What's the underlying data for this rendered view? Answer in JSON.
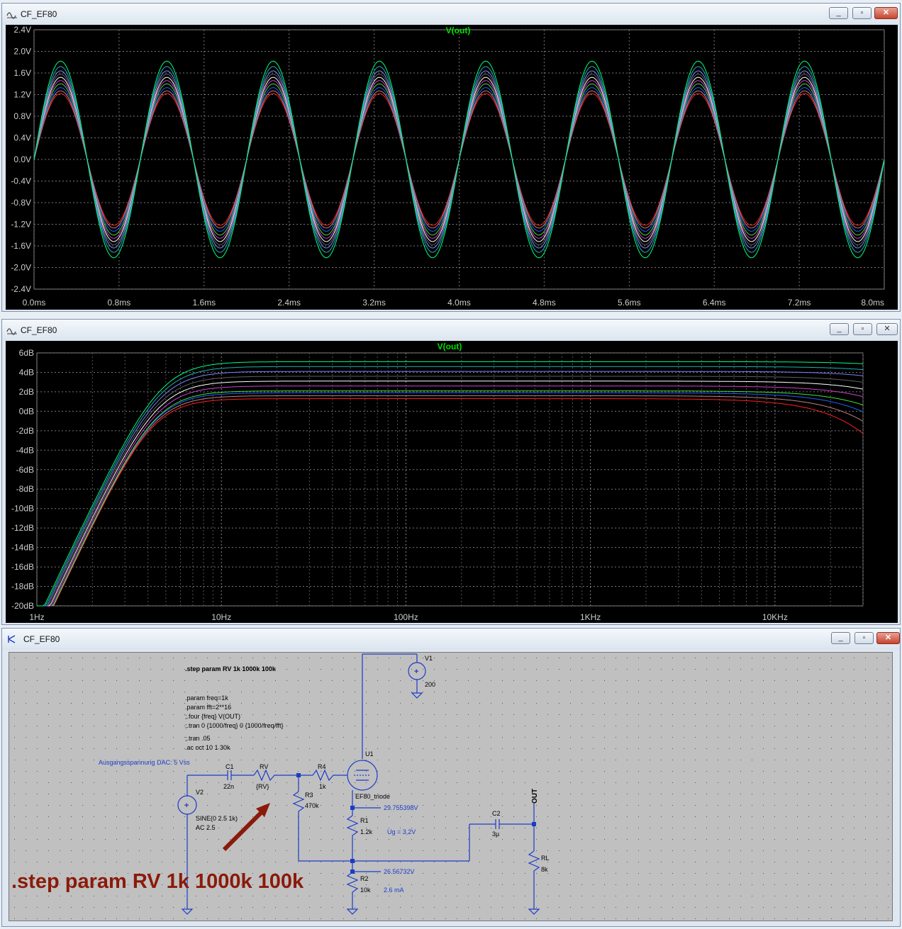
{
  "windows": {
    "transient": {
      "title": "CF_EF80",
      "trace_label": "V(out)",
      "y_ticks": [
        "2.4V",
        "2.0V",
        "1.6V",
        "1.2V",
        "0.8V",
        "0.4V",
        "0.0V",
        "-0.4V",
        "-0.8V",
        "-1.2V",
        "-1.6V",
        "-2.0V",
        "-2.4V"
      ],
      "x_ticks": [
        "0.0ms",
        "0.8ms",
        "1.6ms",
        "2.4ms",
        "3.2ms",
        "4.0ms",
        "4.8ms",
        "5.6ms",
        "6.4ms",
        "7.2ms",
        "8.0ms"
      ]
    },
    "ac": {
      "title": "CF_EF80",
      "trace_label": "V(out)",
      "y_ticks": [
        "6dB",
        "4dB",
        "2dB",
        "0dB",
        "-2dB",
        "-4dB",
        "-6dB",
        "-8dB",
        "-10dB",
        "-12dB",
        "-14dB",
        "-16dB",
        "-18dB",
        "-20dB"
      ],
      "x_ticks": [
        "1Hz",
        "10Hz",
        "100Hz",
        "1KHz",
        "10KHz"
      ]
    },
    "schematic": {
      "title": "CF_EF80",
      "directives": [
        ".step param RV 1k 1000k 100k",
        ".param freq=1k",
        ".param fft=2**16",
        ";.four {freq} V(OUT)",
        ";.tran 0 {1000/freq} 0 {1000/freq/fft}",
        ";.tran .05",
        ".ac oct 10 1 30k"
      ],
      "comment_dac": "Ausgangsspannung DAC: 5 Vss",
      "components": {
        "v1": {
          "name": "V1",
          "value": "200"
        },
        "v2": {
          "name": "V2",
          "value1": "SINE(0 2.5 1k)",
          "value2": "AC 2.5"
        },
        "c1": {
          "name": "C1",
          "value": "22n"
        },
        "rv": {
          "name": "RV",
          "value": "{RV}"
        },
        "r4": {
          "name": "R4",
          "value": "1k"
        },
        "r3": {
          "name": "R3",
          "value": "470k"
        },
        "u1": {
          "name": "U1",
          "value": "EF80_triode"
        },
        "r1": {
          "name": "R1",
          "value": "1.2k"
        },
        "r2": {
          "name": "R2",
          "value": "10k"
        },
        "c2": {
          "name": "C2",
          "value": "3µ"
        },
        "rl": {
          "name": "RL",
          "value": "8k"
        }
      },
      "net_out": "OUT",
      "annotations": {
        "v_cathode": "29.755398V",
        "ug": "Ug = 3,2V",
        "v_mid": "26.56732V",
        "current": "2.6 mA"
      },
      "overlay_text": ".step param RV  1k 1000k 100k"
    }
  },
  "colors": {
    "trace_label": "#00e000",
    "grid": "#8a8a8a",
    "schematic_wire": "#1b3cc8",
    "annotation": "#1b3cc8",
    "overlay": "#8b1a0a"
  }
}
